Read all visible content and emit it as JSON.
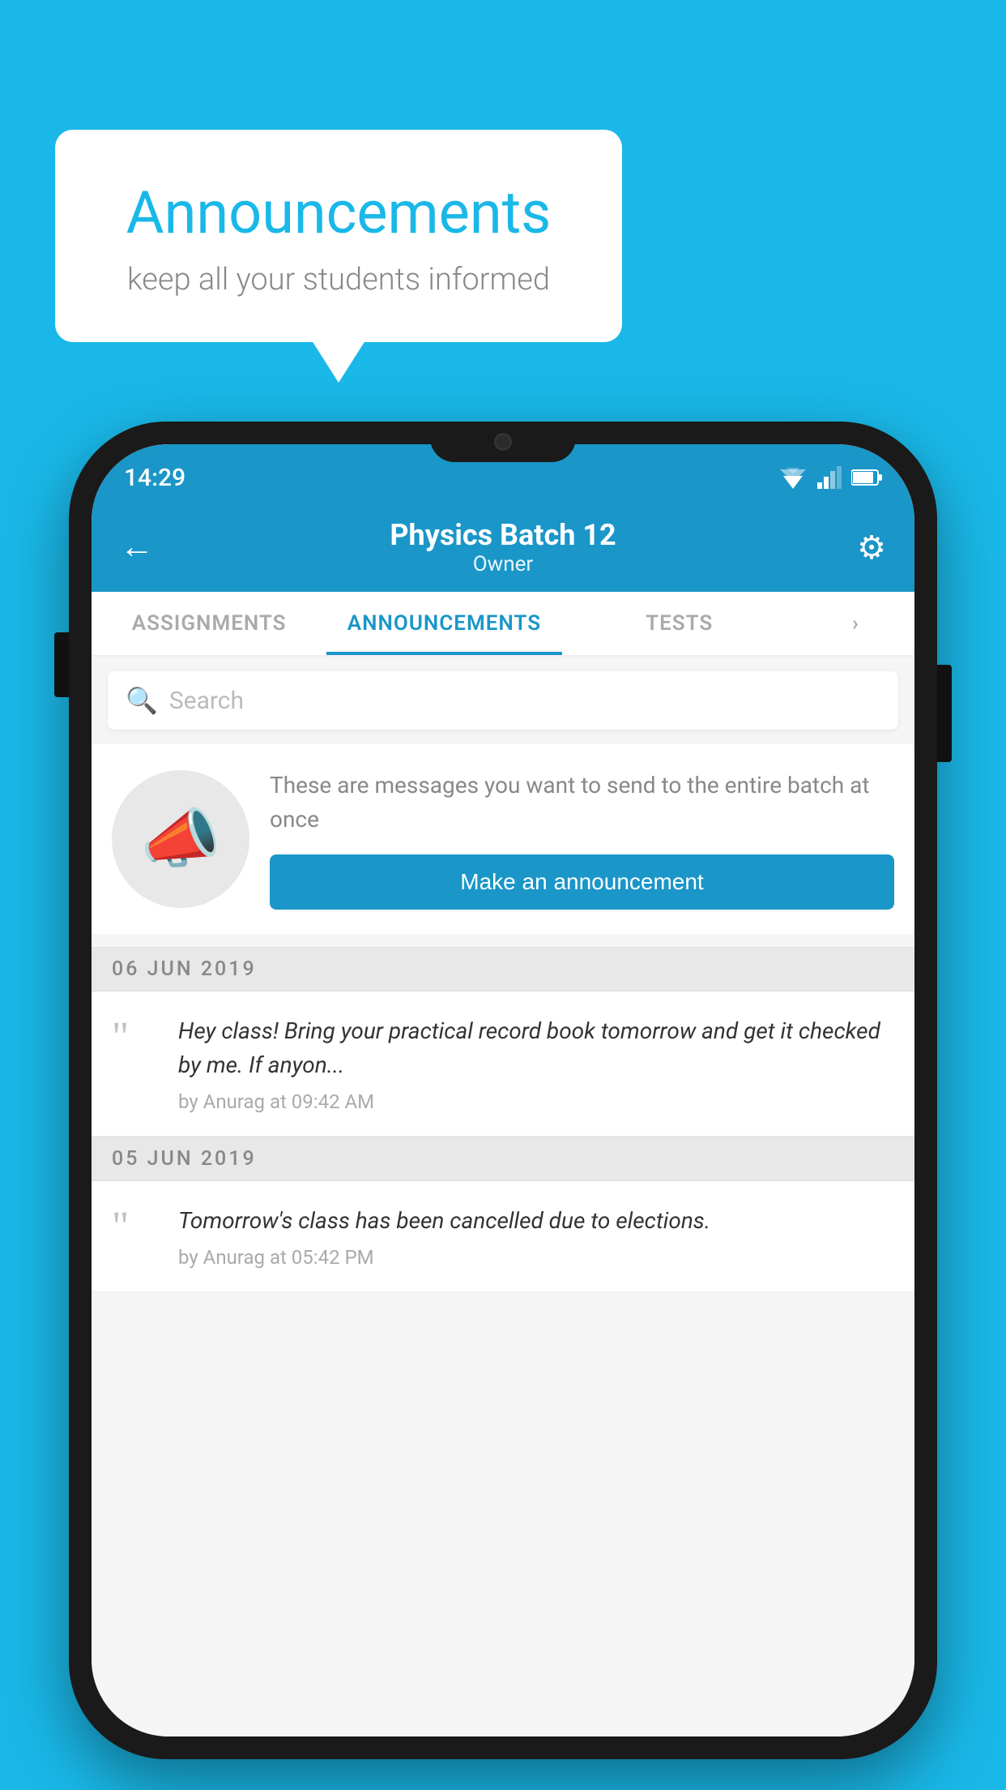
{
  "background_color": "#1ab8e8",
  "speech_bubble": {
    "title": "Announcements",
    "subtitle": "keep all your students informed"
  },
  "phone": {
    "status_bar": {
      "time": "14:29"
    },
    "app_bar": {
      "title": "Physics Batch 12",
      "subtitle": "Owner",
      "back_label": "←",
      "gear_label": "⚙"
    },
    "tabs": [
      {
        "label": "ASSIGNMENTS",
        "active": false
      },
      {
        "label": "ANNOUNCEMENTS",
        "active": true
      },
      {
        "label": "TESTS",
        "active": false
      },
      {
        "label": "",
        "active": false,
        "partial": true
      }
    ],
    "search": {
      "placeholder": "Search"
    },
    "cta": {
      "description": "These are messages you want to send to the entire batch at once",
      "button_label": "Make an announcement"
    },
    "announcements": [
      {
        "date": "06  JUN  2019",
        "text": "Hey class! Bring your practical record book tomorrow and get it checked by me. If anyon...",
        "meta": "by Anurag at 09:42 AM"
      },
      {
        "date": "05  JUN  2019",
        "text": "Tomorrow's class has been cancelled due to elections.",
        "meta": "by Anurag at 05:42 PM"
      }
    ]
  }
}
